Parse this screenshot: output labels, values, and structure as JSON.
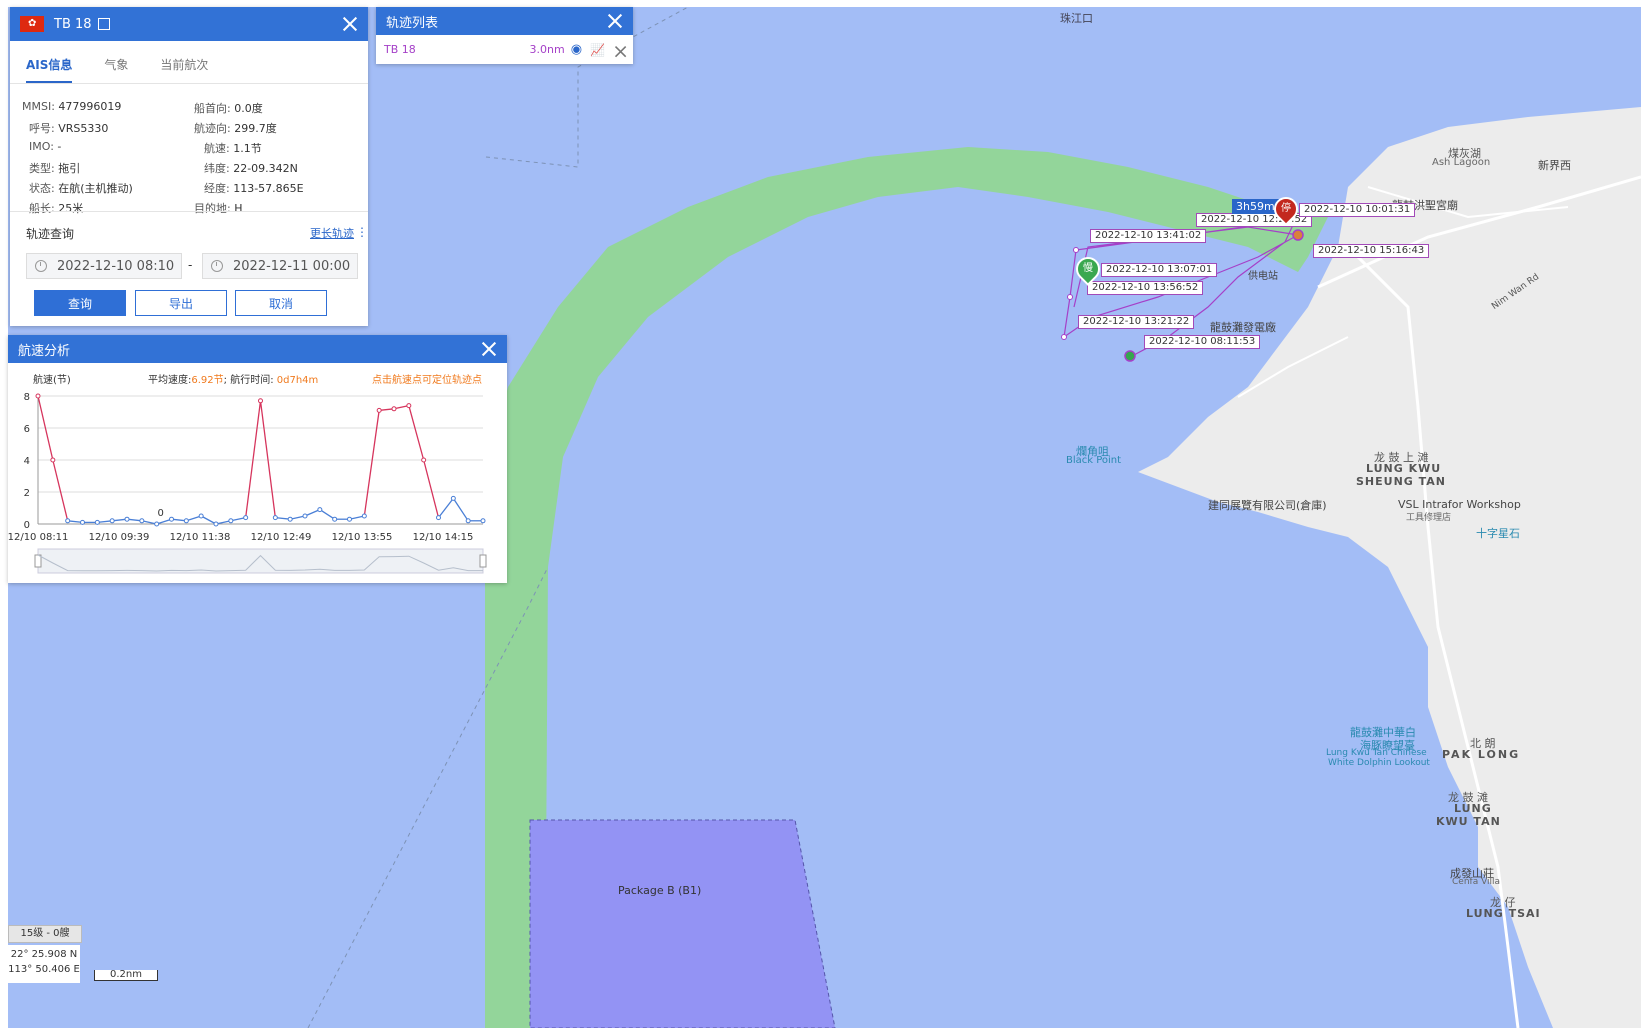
{
  "vessel_panel": {
    "title": "TB 18",
    "tabs": [
      "AIS信息",
      "气象",
      "当前航次"
    ],
    "fields": [
      {
        "k": "MMSI:",
        "v": "477996019"
      },
      {
        "k": "船首向:",
        "v": "0.0度"
      },
      {
        "k": "呼号:",
        "v": "VRS5330"
      },
      {
        "k": "航迹向:",
        "v": "299.7度"
      },
      {
        "k": "IMO:",
        "v": "-"
      },
      {
        "k": "航速:",
        "v": "1.1节"
      },
      {
        "k": "类型:",
        "v": "拖引"
      },
      {
        "k": "纬度:",
        "v": "22-09.342N"
      },
      {
        "k": "状态:",
        "v": "在航(主机推动)"
      },
      {
        "k": "经度:",
        "v": "113-57.865E"
      },
      {
        "k": "船长:",
        "v": "25米"
      },
      {
        "k": "目的地:",
        "v": "H"
      }
    ],
    "query_title": "轨迹查询",
    "more_link": "更长轨迹",
    "start_date": "2022-12-10 08:10",
    "date_sep": "-",
    "end_date": "2022-12-11 00:00",
    "btn_query": "查询",
    "btn_export": "导出",
    "btn_cancel": "取消"
  },
  "track_list": {
    "title": "轨迹列表",
    "item_name": "TB 18",
    "item_dist": "3.0nm"
  },
  "speed_panel": {
    "title": "航速分析",
    "ylabel": "航速(节)",
    "avg_label": "平均速度:",
    "avg_value": "6.92节",
    "time_label": "; 航行时间:",
    "time_value": "0d7h4m",
    "hint": "点击航速点可定位轨迹点",
    "zero_annotation": "0"
  },
  "chart_data": {
    "type": "line",
    "ylabel": "航速(节)",
    "ylim": [
      0,
      8
    ],
    "yticks": [
      0,
      2,
      4,
      6,
      8
    ],
    "xticks": [
      "12/10 08:11",
      "12/10 09:39",
      "12/10 11:38",
      "12/10 12:49",
      "12/10 13:55",
      "12/10 14:15"
    ],
    "series": [
      {
        "values": [
          8.0,
          4.0,
          0.2,
          0.1,
          0.1,
          0.2,
          0.3,
          0.2,
          0.0,
          0.3,
          0.2,
          0.5,
          0.0,
          0.2,
          0.4,
          7.7,
          0.4,
          0.3,
          0.5,
          0.9,
          0.3,
          0.3,
          0.5,
          7.1,
          7.2,
          7.4,
          4.0,
          0.4,
          1.6,
          0.2,
          0.2
        ]
      }
    ]
  },
  "map": {
    "labels": {
      "zhujiangkou": "珠江口",
      "ash_lagoon_cn": "煤灰湖",
      "ash_lagoon_en": "Ash Lagoon",
      "hung_shing": "龍鼓洪聖宮廟",
      "xinjie": "新界西",
      "gongdian": "供电站",
      "power_station": "龍鼓灘發電廠",
      "nim_wan_rd": "Nim Wan Rd",
      "black_point_cn": "爛角咀",
      "black_point_en": "Black Point",
      "lkst_cn": "龙 鼓 上 滩",
      "lkst_en1": "LUNG KWU",
      "lkst_en2": "SHEUNG TAN",
      "jiantong": "建同展覽有限公司(倉庫)",
      "vsl": "VSL Intrafor Workshop",
      "vsl_cn": "工具修理店",
      "shizixing": "十字星石",
      "dolphin_cn1": "龍鼓灘中華白",
      "dolphin_cn2": "海豚瞭望臺",
      "dolphin_en1": "Lung Kwu Tan Chinese",
      "dolphin_en2": "White Dolphin Lookout",
      "paklong_cn": "北 朗",
      "paklong_en": "PAK LONG",
      "lkt_cn": "龙 鼓 滩",
      "lkt_en1": "LUNG",
      "lkt_en2": "KWU TAN",
      "cenfa_cn": "成發山莊",
      "cenfa_en": "Cenfa Villa",
      "lungtsai_cn": "龙 仔",
      "lungtsai_en": "LUNG TSAI",
      "package_b": "Package B (B1)"
    },
    "track_times": [
      "2022-12-10 12:27:52",
      "2022-12-10 10:01:31",
      "2022-12-10 13:41:02",
      "2022-12-10 15:16:43",
      "2022-12-10 13:07:01",
      "2022-12-10 13:56:52",
      "2022-12-10 13:21:22",
      "2022-12-10 08:11:53"
    ],
    "duration_badge": "3h59m",
    "stop_marker": "停",
    "start_marker": "慢",
    "zoom_level": "15级 - 0艘",
    "lat": "22° 25.908 N",
    "lon": "113° 50.406 E",
    "scale": "0.2nm",
    "colors": {
      "sea": "#a3bdf6",
      "channel": "#93d59a",
      "land": "#ececec",
      "zone": "#9393f4",
      "track": "#a540c8",
      "header": "#3272d6"
    }
  }
}
